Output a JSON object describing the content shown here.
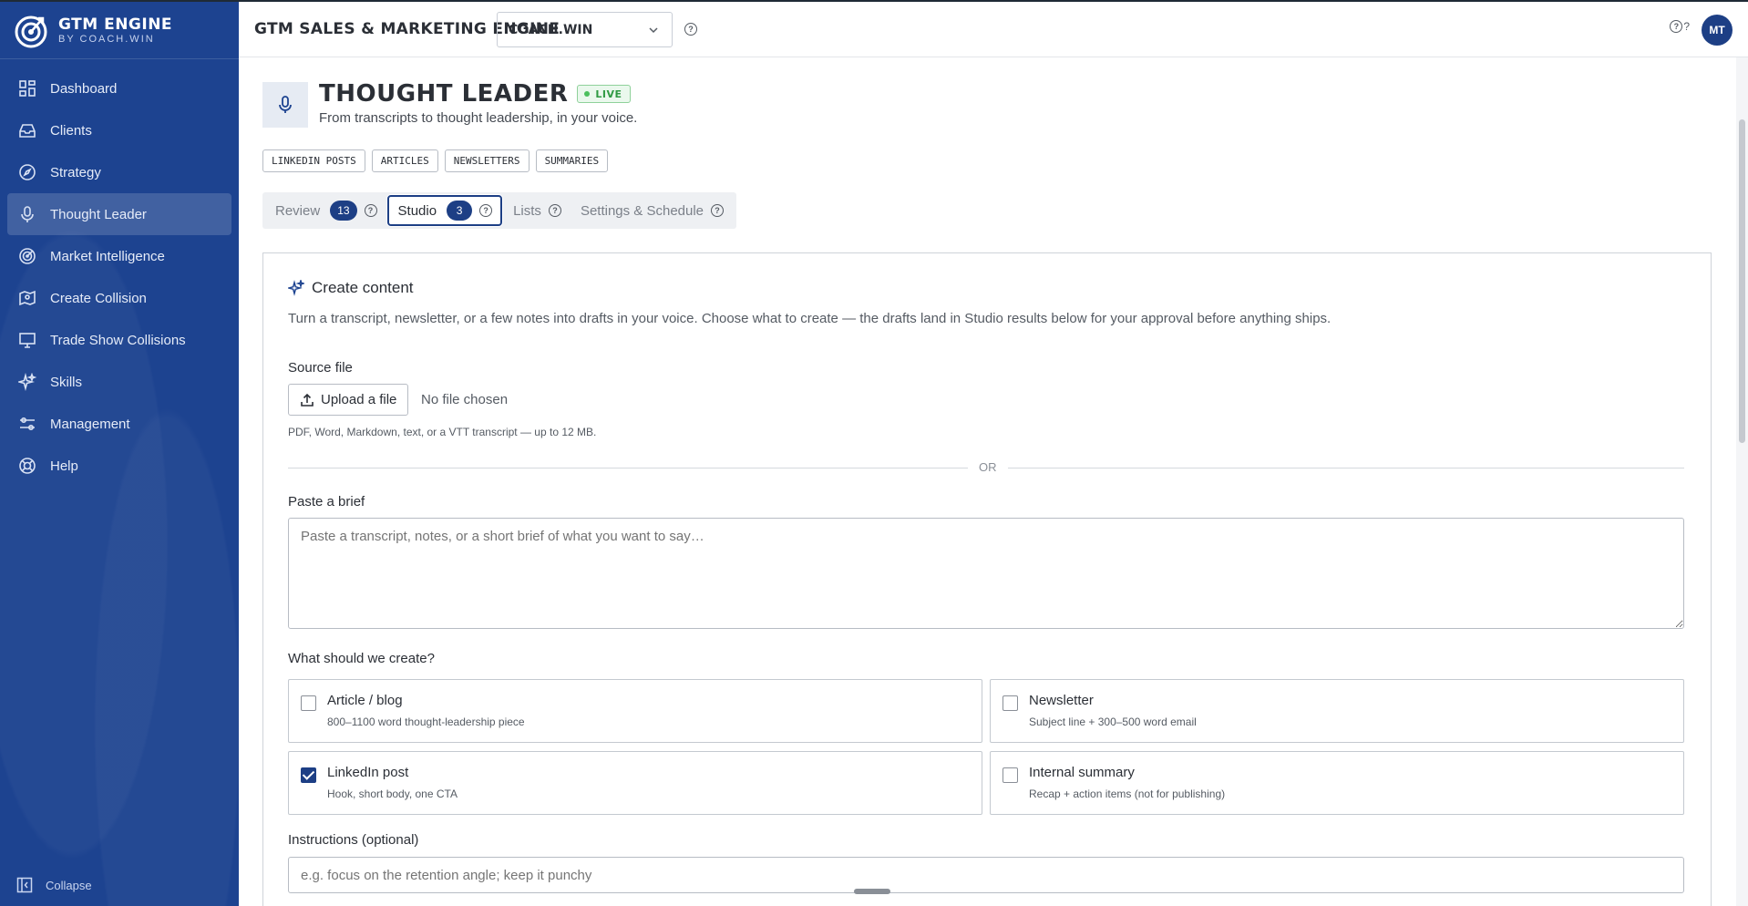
{
  "brand": {
    "title": "GTM ENGINE",
    "subtitle": "BY COACH.WIN"
  },
  "sidebar": {
    "items": [
      {
        "label": "Dashboard",
        "icon": "grid-icon"
      },
      {
        "label": "Clients",
        "icon": "inbox-icon"
      },
      {
        "label": "Strategy",
        "icon": "compass-icon"
      },
      {
        "label": "Thought Leader",
        "icon": "microphone-icon",
        "active": true
      },
      {
        "label": "Market Intelligence",
        "icon": "radar-icon"
      },
      {
        "label": "Create Collision",
        "icon": "map-icon"
      },
      {
        "label": "Trade Show Collisions",
        "icon": "monitor-icon"
      },
      {
        "label": "Skills",
        "icon": "sparkle-icon"
      },
      {
        "label": "Management",
        "icon": "sliders-icon"
      },
      {
        "label": "Help",
        "icon": "lifebuoy-icon"
      }
    ],
    "collapse_label": "Collapse"
  },
  "header": {
    "title": "GTM SALES & MARKETING ENGINE",
    "workspace": "COACH.WIN",
    "help_mark": "?",
    "user_initials": "MT"
  },
  "page": {
    "title": "THOUGHT LEADER",
    "badge": "LIVE",
    "subtitle": "From transcripts to thought leadership, in your voice.",
    "chips": [
      "LINKEDIN POSTS",
      "ARTICLES",
      "NEWSLETTERS",
      "SUMMARIES"
    ],
    "tabs": [
      {
        "label": "Review",
        "count": "13"
      },
      {
        "label": "Studio",
        "count": "3",
        "active": true
      },
      {
        "label": "Lists"
      },
      {
        "label": "Settings & Schedule"
      }
    ]
  },
  "create": {
    "heading": "Create content",
    "description": "Turn a transcript, newsletter, or a few notes into drafts in your voice. Choose what to create — the drafts land in Studio results below for your approval before anything ships.",
    "source_label": "Source file",
    "upload_label": "Upload a file",
    "file_status": "No file chosen",
    "file_hint": "PDF, Word, Markdown, text, or a VTT transcript — up to 12 MB.",
    "divider": "OR",
    "brief_label": "Paste a brief",
    "brief_placeholder": "Paste a transcript, notes, or a short brief of what you want to say…",
    "options_label": "What should we create?",
    "options": [
      {
        "title": "Article / blog",
        "desc": "800–1100 word thought-leadership piece",
        "checked": false
      },
      {
        "title": "Newsletter",
        "desc": "Subject line + 300–500 word email",
        "checked": false
      },
      {
        "title": "LinkedIn post",
        "desc": "Hook, short body, one CTA",
        "checked": true
      },
      {
        "title": "Internal summary",
        "desc": "Recap + action items (not for publishing)",
        "checked": false
      }
    ],
    "instructions_label": "Instructions (optional)",
    "instructions_placeholder": "e.g. focus on the retention angle; keep it punchy"
  },
  "colors": {
    "sidebar": "#1d4390",
    "accent": "#1d3f85",
    "live": "#2f9a43"
  }
}
